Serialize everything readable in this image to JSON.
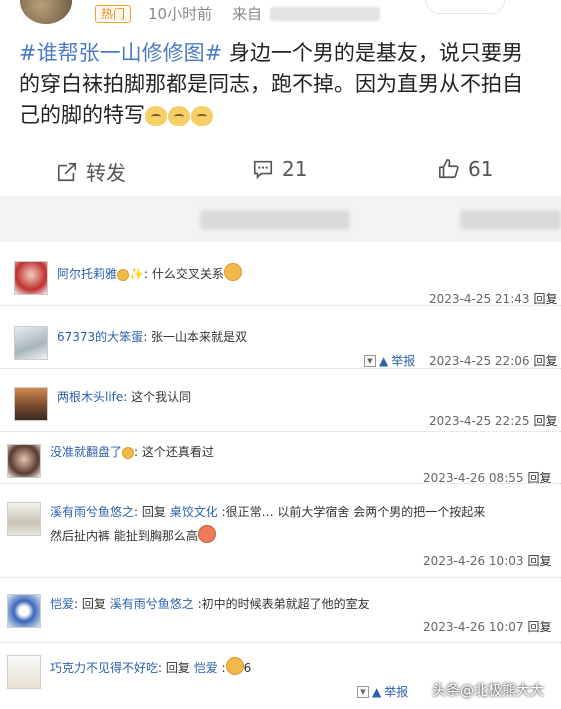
{
  "post": {
    "hot_label": "热门",
    "time": "10小时前",
    "from_label": "来自",
    "hashtag": "#谁帮张一山修修图#",
    "body": " 身边一个男的是基友，说只要男的穿白袜拍脚那都是同志，跑不掉。因为直男从不拍自己的脚的特写"
  },
  "actions": {
    "repost_label": "转发",
    "comment_count": "21",
    "like_count": "61"
  },
  "comments": [
    {
      "user": "阿尔托莉雅",
      "text": "什么交叉关系",
      "time": "2023-4-25 21:43",
      "reply": "回复"
    },
    {
      "user": "67373的大笨蛋",
      "text": "张一山本来就是双",
      "report": "举报",
      "time": "2023-4-25 22:06",
      "reply": "回复"
    },
    {
      "user": "两根木头life",
      "text": "这个我认同",
      "time": "2023-4-25 22:25",
      "reply": "回复"
    },
    {
      "user": "没准就翻盘了",
      "text": "这个还真看过",
      "time": "2023-4-26 08:55",
      "reply": "回复"
    },
    {
      "user": "溪有雨兮鱼悠之",
      "reply_word": "回复",
      "mention": "桌饺文化",
      "text_line1": ":很正常… 以前大学宿舍 会两个男的把一个按起来",
      "text_line2": "然后扯内裤 能扯到胸那么高",
      "time": "2023-4-26 10:03",
      "reply": "回复"
    },
    {
      "user": "恺爱",
      "reply_word": "回复",
      "mention": "溪有雨兮鱼悠之",
      "text": ":初中的时候表弟就超了他的室友",
      "time": "2023-4-26 10:07",
      "reply": "回复"
    },
    {
      "user": "巧克力不见得不好吃",
      "reply_word": "回复",
      "mention": "恺爱",
      "text_after": "6",
      "report": "举报"
    }
  ],
  "watermark": "头条@北极熊大大"
}
